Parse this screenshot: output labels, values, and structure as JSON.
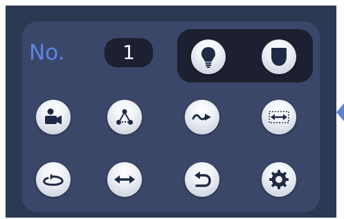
{
  "panel": {
    "number_label": "No.",
    "number_value": "1"
  },
  "buttons": [
    {
      "name": "light-button",
      "icon": "light-bulb-icon"
    },
    {
      "name": "wiper-button",
      "icon": "camera-dome-icon"
    },
    {
      "name": "preset-button",
      "icon": "camera-icon"
    },
    {
      "name": "tour-button",
      "icon": "tour-icon"
    },
    {
      "name": "pattern-button",
      "icon": "pattern-icon"
    },
    {
      "name": "scan-button",
      "icon": "scan-icon"
    },
    {
      "name": "rotate-button",
      "icon": "rotate-icon"
    },
    {
      "name": "pan-button",
      "icon": "pan-icon"
    },
    {
      "name": "go-back-button",
      "icon": "return-icon"
    },
    {
      "name": "settings-button",
      "icon": "gear-icon"
    }
  ],
  "colors": {
    "frame_bg": "#2c3953",
    "panel_bg": "#3a4768",
    "dark_group_bg": "#1c2030",
    "label_blue": "#5a84e6",
    "icon_dark": "#1f2a44",
    "side_arrow": "#5b84d8"
  }
}
